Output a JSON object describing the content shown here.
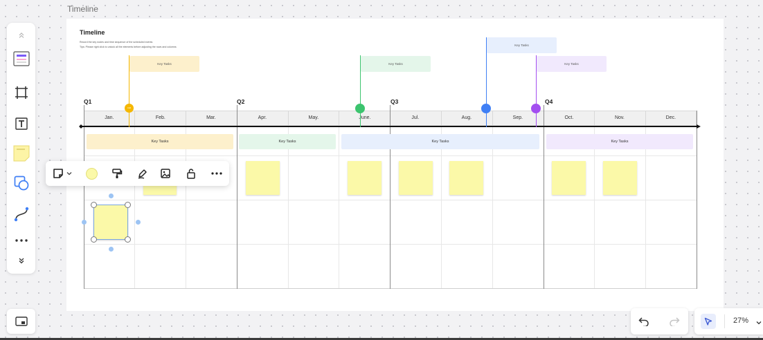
{
  "frame": {
    "label": "Timeline"
  },
  "timeline": {
    "title": "Timeline",
    "desc1": "Record the key nodes and time sequence of the scheduled events",
    "desc2": "Tips: Please right click to unlock all the elements before adjusting the rows and columns",
    "quarters": [
      "Q1",
      "Q2",
      "Q3",
      "Q4"
    ],
    "months": [
      "Jan.",
      "Feb.",
      "Mar.",
      "Apr.",
      "May.",
      "June.",
      "Jul.",
      "Aug.",
      "Sep.",
      "Oct.",
      "Nov.",
      "Dec."
    ],
    "flags": [
      "Key Tasks",
      "Key Tasks",
      "Key Tasks",
      "Key Tasks"
    ],
    "milestone_badge": "Add",
    "bands": [
      "Key Tasks",
      "Key Tasks",
      "Key Tasks",
      "Key Tasks"
    ]
  },
  "colors": {
    "orange": "#f5b700",
    "green": "#3cc46e",
    "blue": "#3f7ff5",
    "purple": "#a34ef0",
    "band_yellow": "#fdf0cc",
    "band_green": "#e4f6ea",
    "band_blue": "#e7effd",
    "band_purple": "#f1e9fd",
    "sticky": "#fbf9a8",
    "selection": "#7aa7e0"
  },
  "left_toolbar": {
    "tools": [
      "chevron-up-icon",
      "template-icon",
      "frame-icon",
      "text-icon",
      "sticky-note-icon",
      "shapes-icon",
      "connector-icon",
      "more-icon",
      "chevron-double-down-icon"
    ]
  },
  "context_toolbar": {
    "tools": [
      "sticky-note-shape-icon",
      "chevron-down-icon",
      "fill-color-icon",
      "format-painter-icon",
      "pen-icon",
      "image-icon",
      "unlock-icon",
      "more-icon"
    ]
  },
  "zoom": {
    "level": "27%"
  }
}
